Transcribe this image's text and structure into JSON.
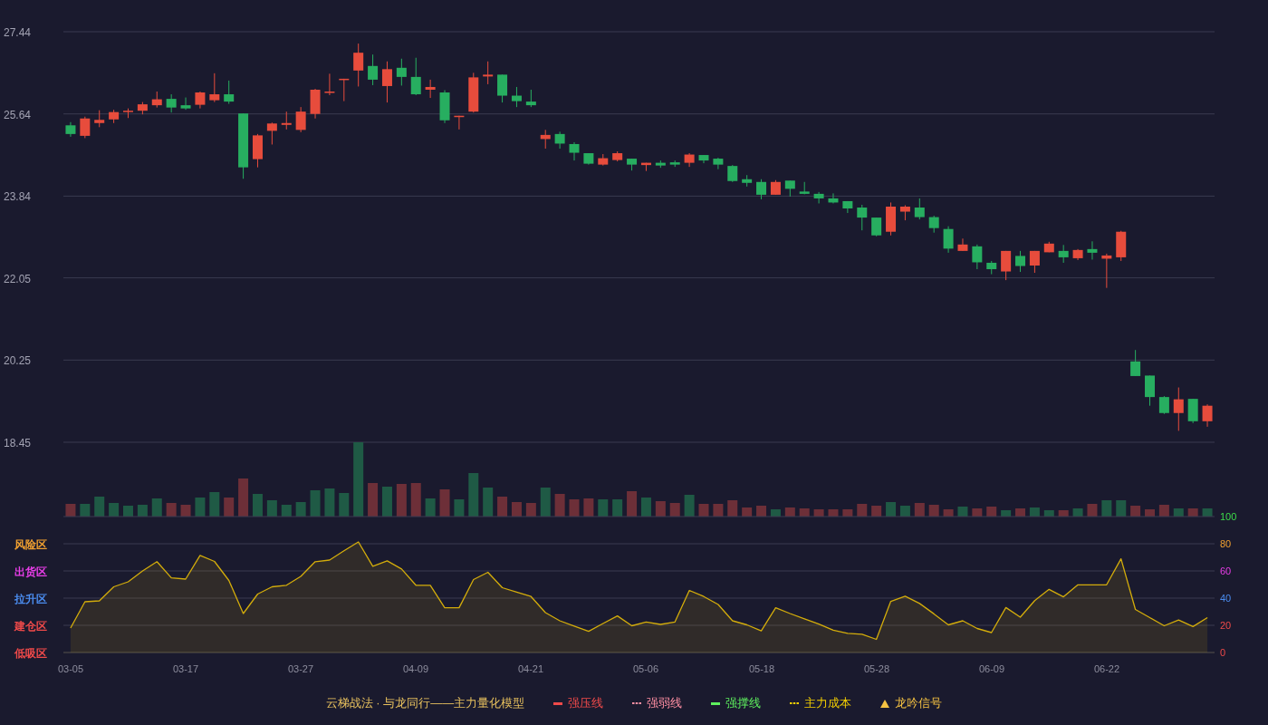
{
  "price_chart": {
    "chart_data": {
      "type": "candlestick",
      "grid": true,
      "categories": [
        null,
        null,
        null,
        null,
        null,
        null,
        null,
        null,
        null,
        null,
        null,
        null,
        null,
        null,
        null,
        null,
        null,
        null,
        null,
        null,
        null,
        null,
        null,
        null,
        null,
        null,
        null,
        null,
        null,
        null,
        null,
        null,
        null,
        null,
        null,
        null,
        null,
        null,
        null,
        null,
        null,
        null,
        null,
        null,
        null,
        null,
        null,
        null,
        null,
        null,
        null,
        null,
        null,
        null,
        null,
        null,
        null,
        null,
        null,
        null,
        null,
        null,
        null,
        null,
        null,
        null,
        null,
        null,
        null,
        null,
        null,
        null,
        null,
        null,
        null,
        null,
        null,
        null,
        null,
        null
      ],
      "ylim": [
        18.45,
        27.44
      ],
      "yticks": [
        {
          "value": 18.45,
          "label": "18.45"
        },
        {
          "value": 20.25,
          "label": "20.25"
        },
        {
          "value": 22.05,
          "label": "22.05"
        },
        {
          "value": 23.84,
          "label": "23.84"
        },
        {
          "value": 25.64,
          "label": "25.64"
        },
        {
          "value": 27.44,
          "label": "27.44"
        }
      ],
      "ohlc": [
        [
          25.39,
          25.46,
          25.14,
          25.2
        ],
        [
          25.16,
          25.58,
          25.11,
          25.54
        ],
        [
          25.44,
          25.72,
          25.35,
          25.51
        ],
        [
          25.52,
          25.73,
          25.44,
          25.68
        ],
        [
          25.68,
          25.76,
          25.55,
          25.71
        ],
        [
          25.71,
          25.9,
          25.63,
          25.85
        ],
        [
          25.83,
          26.13,
          25.78,
          25.96
        ],
        [
          25.97,
          26.07,
          25.67,
          25.78
        ],
        [
          25.83,
          26.0,
          25.73,
          25.76
        ],
        [
          25.84,
          26.13,
          25.76,
          26.11
        ],
        [
          25.94,
          26.53,
          25.9,
          26.07
        ],
        [
          26.07,
          26.37,
          25.86,
          25.91
        ],
        [
          25.65,
          25.65,
          24.22,
          24.47
        ],
        [
          24.65,
          25.2,
          24.47,
          25.17
        ],
        [
          25.27,
          25.45,
          24.97,
          25.43
        ],
        [
          25.4,
          25.69,
          25.3,
          25.44
        ],
        [
          25.29,
          25.79,
          25.24,
          25.69
        ],
        [
          25.64,
          26.19,
          25.54,
          26.17
        ],
        [
          26.1,
          26.52,
          26.05,
          26.13
        ],
        [
          26.38,
          26.41,
          25.92,
          26.41
        ],
        [
          26.59,
          27.18,
          26.24,
          26.98
        ],
        [
          26.69,
          26.94,
          26.27,
          26.39
        ],
        [
          26.25,
          26.79,
          25.89,
          26.62
        ],
        [
          26.65,
          26.85,
          26.26,
          26.45
        ],
        [
          26.45,
          26.87,
          26.05,
          26.07
        ],
        [
          26.17,
          26.39,
          25.99,
          26.23
        ],
        [
          26.11,
          26.16,
          25.44,
          25.5
        ],
        [
          25.57,
          25.6,
          25.3,
          25.6
        ],
        [
          25.69,
          26.54,
          25.67,
          26.44
        ],
        [
          26.46,
          26.79,
          26.29,
          26.5
        ],
        [
          26.5,
          26.5,
          25.89,
          26.04
        ],
        [
          26.04,
          26.23,
          25.79,
          25.92
        ],
        [
          25.91,
          26.17,
          25.79,
          25.83
        ],
        [
          25.09,
          25.29,
          24.88,
          25.18
        ],
        [
          25.2,
          25.25,
          24.88,
          24.99
        ],
        [
          24.98,
          25.02,
          24.62,
          24.79
        ],
        [
          24.78,
          24.78,
          24.53,
          24.55
        ],
        [
          24.53,
          24.76,
          24.51,
          24.67
        ],
        [
          24.63,
          24.82,
          24.6,
          24.78
        ],
        [
          24.66,
          24.66,
          24.4,
          24.53
        ],
        [
          24.52,
          24.57,
          24.39,
          24.57
        ],
        [
          24.57,
          24.62,
          24.46,
          24.51
        ],
        [
          24.58,
          24.62,
          24.48,
          24.53
        ],
        [
          24.57,
          24.78,
          24.48,
          24.75
        ],
        [
          24.74,
          24.74,
          24.56,
          24.62
        ],
        [
          24.66,
          24.68,
          24.43,
          24.53
        ],
        [
          24.5,
          24.52,
          24.15,
          24.17
        ],
        [
          24.21,
          24.3,
          24.05,
          24.13
        ],
        [
          24.15,
          24.21,
          23.77,
          23.87
        ],
        [
          23.87,
          24.19,
          23.87,
          24.15
        ],
        [
          24.18,
          24.18,
          23.83,
          24.0
        ],
        [
          23.94,
          24.15,
          23.88,
          23.89
        ],
        [
          23.89,
          23.93,
          23.68,
          23.79
        ],
        [
          23.79,
          23.9,
          23.68,
          23.7
        ],
        [
          23.73,
          23.73,
          23.47,
          23.57
        ],
        [
          23.59,
          23.65,
          23.09,
          23.37
        ],
        [
          23.37,
          23.37,
          22.96,
          22.98
        ],
        [
          23.06,
          23.7,
          22.98,
          23.61
        ],
        [
          23.5,
          23.64,
          23.31,
          23.61
        ],
        [
          23.59,
          23.79,
          23.33,
          23.38
        ],
        [
          23.38,
          23.41,
          23.04,
          23.14
        ],
        [
          23.12,
          23.18,
          22.6,
          22.69
        ],
        [
          22.64,
          22.91,
          22.64,
          22.78
        ],
        [
          22.74,
          22.78,
          22.24,
          22.39
        ],
        [
          22.38,
          22.42,
          22.13,
          22.24
        ],
        [
          22.19,
          22.64,
          22.0,
          22.64
        ],
        [
          22.53,
          22.64,
          22.18,
          22.31
        ],
        [
          22.32,
          22.64,
          22.16,
          22.64
        ],
        [
          22.61,
          22.84,
          22.61,
          22.8
        ],
        [
          22.64,
          22.77,
          22.38,
          22.5
        ],
        [
          22.48,
          22.68,
          22.44,
          22.66
        ],
        [
          22.68,
          22.85,
          22.45,
          22.6
        ],
        [
          22.47,
          22.58,
          21.83,
          22.54
        ],
        [
          22.5,
          23.08,
          22.42,
          23.06
        ],
        [
          20.22,
          20.47,
          19.9,
          19.9
        ],
        [
          19.91,
          19.91,
          19.25,
          19.44
        ],
        [
          19.44,
          19.46,
          19.07,
          19.09
        ],
        [
          19.09,
          19.65,
          18.7,
          19.39
        ],
        [
          19.4,
          19.4,
          18.87,
          18.91
        ],
        [
          18.91,
          19.28,
          18.79,
          19.25
        ]
      ]
    }
  },
  "indicator_panel": {
    "levels": [
      {
        "zone": "风险区",
        "color": "#f0a030"
      },
      {
        "zone": "出货区",
        "color": "#e83ee8"
      },
      {
        "zone": "拉升区",
        "color": "#4b8df0"
      },
      {
        "zone": "建仓区",
        "color": "#f04a4a"
      },
      {
        "zone": "低吸区",
        "color": "#f04a4a"
      }
    ],
    "chart_data": {
      "type": "area",
      "grid": true,
      "ylim": [
        0,
        100
      ],
      "yticks": [
        {
          "value": 0,
          "label": "0"
        },
        {
          "value": 20,
          "label": "20"
        },
        {
          "value": 40,
          "label": "40"
        },
        {
          "value": 60,
          "label": "60"
        },
        {
          "value": 80,
          "label": "80"
        },
        {
          "value": 100,
          "label": "100"
        }
      ],
      "categories": [
        "03-05",
        null,
        null,
        null,
        null,
        null,
        null,
        null,
        "03-17",
        null,
        null,
        null,
        null,
        null,
        null,
        null,
        "03-27",
        null,
        null,
        null,
        null,
        null,
        null,
        null,
        "04-09",
        null,
        null,
        null,
        null,
        null,
        null,
        null,
        "04-21",
        null,
        null,
        null,
        null,
        null,
        null,
        null,
        "05-06",
        null,
        null,
        null,
        null,
        null,
        null,
        null,
        "05-18",
        null,
        null,
        null,
        null,
        null,
        null,
        null,
        "05-28",
        null,
        null,
        null,
        null,
        null,
        null,
        null,
        "06-09",
        null,
        null,
        null,
        null,
        null,
        null,
        null,
        "06-22",
        null,
        null,
        null,
        null,
        null,
        null,
        null
      ],
      "values": [
        18,
        37.3,
        38,
        48.3,
        52,
        60,
        66.8,
        54.9,
        54,
        71.5,
        67,
        53,
        28.7,
        43,
        48.3,
        49.5,
        56,
        66.8,
        68,
        74.8,
        81.3,
        63.5,
        67.4,
        61.4,
        49.5,
        49.5,
        32.9,
        32.9,
        53.7,
        59,
        47.7,
        44.5,
        41.2,
        29.3,
        23.3,
        19.5,
        15.6,
        21.3,
        26.9,
        19.7,
        22.5,
        20.7,
        22.5,
        45.7,
        41.2,
        35.3,
        23.3,
        20.3,
        15.9,
        32.9,
        28.7,
        24.8,
        20.9,
        16.5,
        14.1,
        13.5,
        9.7,
        37.6,
        41.5,
        36.1,
        28.4,
        20.3,
        23.3,
        17.7,
        14.7,
        33.1,
        26,
        38.2,
        46.5,
        40.9,
        49.8,
        49.8,
        49.8,
        68.9,
        31.7,
        25.7,
        19.7,
        23.9,
        19.1,
        25.7
      ]
    }
  },
  "legend": {
    "title": "云梯战法 · 与龙同行——主力量化模型",
    "items": [
      {
        "label": "强压线",
        "kind": "solid",
        "color": "#f04a4a"
      },
      {
        "label": "强弱线",
        "kind": "dashed",
        "color": "#ff8fa3"
      },
      {
        "label": "强撑线",
        "kind": "solid",
        "color": "#5ef05e"
      },
      {
        "label": "主力成本",
        "kind": "dashed",
        "color": "#f5d000"
      },
      {
        "label": "龙吟信号",
        "kind": "triangle",
        "color": "#f5c242"
      }
    ]
  }
}
